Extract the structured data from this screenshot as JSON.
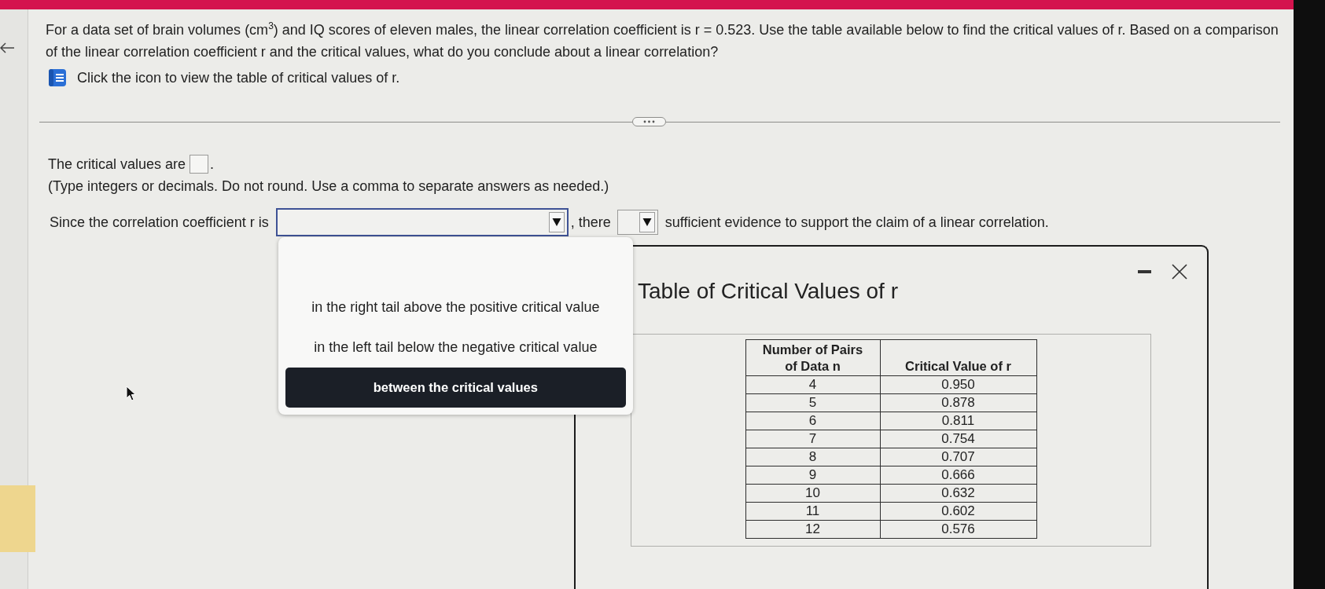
{
  "question": {
    "text": "For a data set of brain volumes (cm$^{3}$) and IQ scores of eleven males, the linear correlation coefficient is r = 0.523. Use the table available below to find the critical values of r. Based on a comparison of the linear correlation coefficient r and the critical values, what do you conclude about a linear correlation?",
    "help": "Click the icon to view the table of critical values of r."
  },
  "answer": {
    "label": "The critical values are",
    "label_end": ".",
    "hint": "(Type integers or decimals. Do not round. Use a comma to separate answers as needed.)"
  },
  "conclusion": {
    "lead": "Since the correlation coefficient r is",
    "dropdowns": [
      {
        "expanded": true,
        "options": [
          {
            "label": "in the right tail above the positive critical value",
            "selected": false
          },
          {
            "label": "in the left tail below the negative critical value",
            "selected": false
          },
          {
            "label": "between the critical values",
            "selected": true
          }
        ]
      },
      {
        "expanded": false
      }
    ],
    "middle": ", there",
    "tail": "sufficient evidence to support the claim of a linear correlation."
  },
  "dialog": {
    "title": "Table of Critical Values of r",
    "table": {
      "columns": [
        "Number of Pairs of Data n",
        "Critical Value of r"
      ],
      "rows": [
        [
          "4",
          "0.950"
        ],
        [
          "5",
          "0.878"
        ],
        [
          "6",
          "0.811"
        ],
        [
          "7",
          "0.754"
        ],
        [
          "8",
          "0.707"
        ],
        [
          "9",
          "0.666"
        ],
        [
          "10",
          "0.632"
        ],
        [
          "11",
          "0.602"
        ],
        [
          "12",
          "0.576"
        ]
      ]
    }
  }
}
